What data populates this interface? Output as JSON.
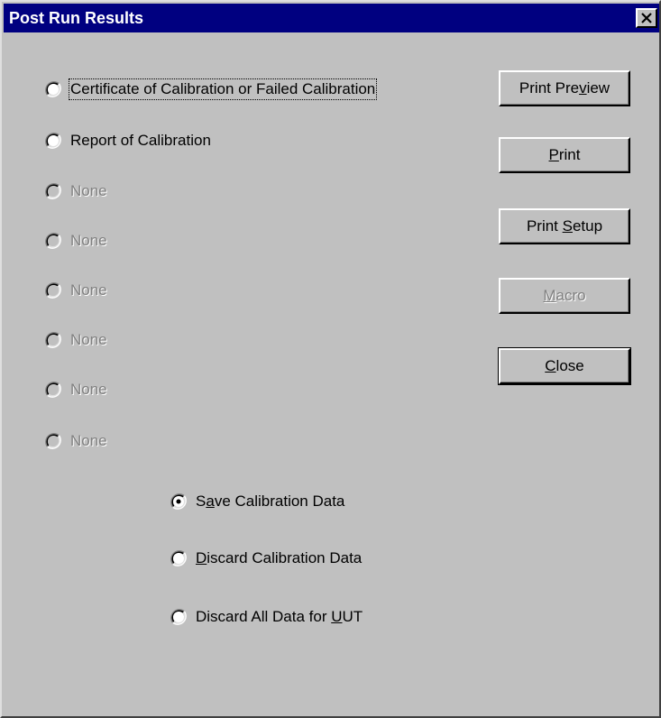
{
  "window": {
    "title": "Post Run Results"
  },
  "report_options": [
    {
      "label": "Certificate of Calibration or Failed Calibration",
      "enabled": true,
      "selected": false
    },
    {
      "label": "Report of Calibration",
      "enabled": true,
      "selected": false
    },
    {
      "label": "None",
      "enabled": false,
      "selected": false
    },
    {
      "label": "None",
      "enabled": false,
      "selected": false
    },
    {
      "label": "None",
      "enabled": false,
      "selected": false
    },
    {
      "label": "None",
      "enabled": false,
      "selected": false
    },
    {
      "label": "None",
      "enabled": false,
      "selected": false
    },
    {
      "label": "None",
      "enabled": false,
      "selected": false
    }
  ],
  "data_options": [
    {
      "label": "Save Calibration Data",
      "selected": true
    },
    {
      "label": "Discard Calibration Data",
      "selected": false
    },
    {
      "label": "Discard All Data for UUT",
      "selected": false
    }
  ],
  "buttons": {
    "print_preview": "Print Preview",
    "print": "Print",
    "print_setup": "Print Setup",
    "macro": "Macro",
    "close": "Close"
  },
  "icons": {
    "close": "close-icon",
    "radio": "radio-button-icon"
  }
}
